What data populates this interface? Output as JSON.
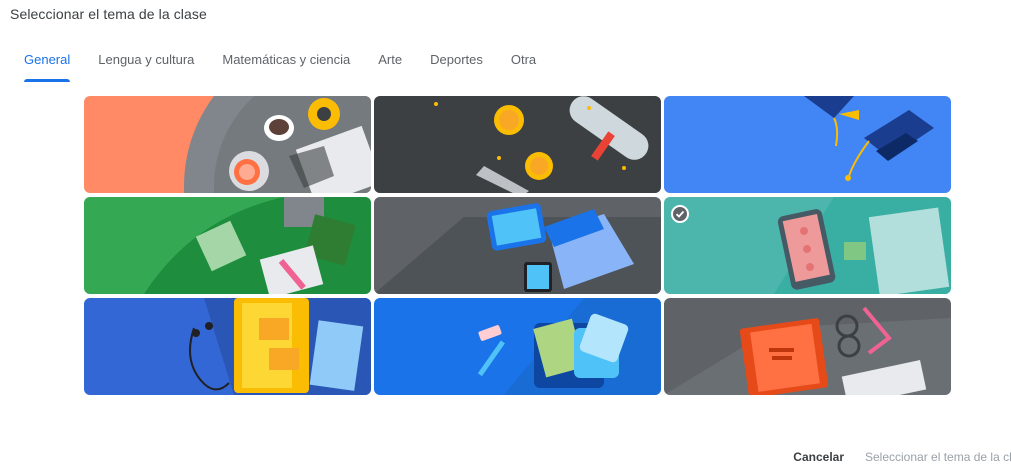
{
  "dialog": {
    "title": "Seleccionar el tema de la clase"
  },
  "tabs": [
    {
      "label": "General",
      "active": true
    },
    {
      "label": "Lengua y cultura",
      "active": false
    },
    {
      "label": "Matemáticas y ciencia",
      "active": false
    },
    {
      "label": "Arte",
      "active": false
    },
    {
      "label": "Deportes",
      "active": false
    },
    {
      "label": "Otra",
      "active": false
    }
  ],
  "themes": [
    {
      "name": "coffee-tea",
      "colors": [
        "#ff8a65",
        "#5f6368"
      ],
      "selected": false
    },
    {
      "name": "graduation-diploma",
      "colors": [
        "#3c4043"
      ],
      "selected": false
    },
    {
      "name": "graduation-caps",
      "colors": [
        "#4285f4"
      ],
      "selected": false
    },
    {
      "name": "books-notes",
      "colors": [
        "#34a853",
        "#1e8e3e"
      ],
      "selected": false
    },
    {
      "name": "laptop-phone",
      "colors": [
        "#5f6368"
      ],
      "selected": false
    },
    {
      "name": "tablet-paper",
      "colors": [
        "#4db6ac"
      ],
      "selected": true
    },
    {
      "name": "headphones-book",
      "colors": [
        "#3367d6"
      ],
      "selected": false
    },
    {
      "name": "backpack",
      "colors": [
        "#1a73e8"
      ],
      "selected": false
    },
    {
      "name": "book-glasses",
      "colors": [
        "#5f6368"
      ],
      "selected": false
    }
  ],
  "footer": {
    "cancel_label": "Cancelar",
    "select_label": "Seleccionar el tema de la clase"
  }
}
